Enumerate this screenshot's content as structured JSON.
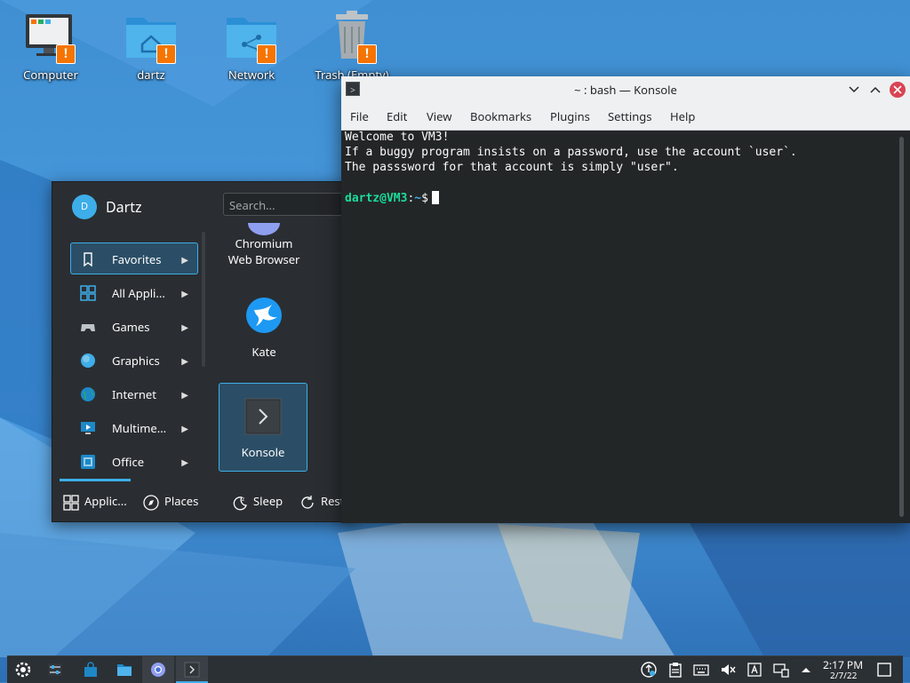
{
  "desktop": {
    "icons": [
      {
        "label": "Computer",
        "badge": "!"
      },
      {
        "label": "dartz",
        "badge": "!"
      },
      {
        "label": "Network",
        "badge": "!"
      },
      {
        "label": "Trash (Empty)",
        "badge": "!"
      }
    ]
  },
  "launcher": {
    "user_initial": "D",
    "user_name": "Dartz",
    "search_placeholder": "Search...",
    "categories": [
      {
        "label": "Favorites",
        "icon": "bookmark-icon"
      },
      {
        "label": "All Appli...",
        "icon": "grid-icon"
      },
      {
        "label": "Games",
        "icon": "gamepad-icon"
      },
      {
        "label": "Graphics",
        "icon": "graphics-icon"
      },
      {
        "label": "Internet",
        "icon": "globe-icon"
      },
      {
        "label": "Multime...",
        "icon": "multimedia-icon"
      },
      {
        "label": "Office",
        "icon": "office-icon"
      }
    ],
    "apps": [
      {
        "label": "Chromium\nWeb Browser",
        "line1": "Chromium",
        "line2": "Web Browser"
      },
      {
        "label": "Kate"
      },
      {
        "label": "Konsole"
      }
    ],
    "footer": {
      "applications": "Applic...",
      "places": "Places",
      "sleep": "Sleep",
      "restart": "Rest"
    }
  },
  "konsole": {
    "title": "~ : bash — Konsole",
    "menu": [
      "File",
      "Edit",
      "View",
      "Bookmarks",
      "Plugins",
      "Settings",
      "Help"
    ],
    "output_lines": [
      "Welcome to VM3!",
      "If a buggy program insists on a password, use the account `user`.",
      "The passsword for that account is simply \"user\"."
    ],
    "prompt_user": "dartz@VM3",
    "prompt_sep": ":",
    "prompt_path": "~",
    "prompt_symbol": "$"
  },
  "taskbar": {
    "clock_time": "2:17 PM",
    "clock_date": "2/7/22"
  },
  "colors": {
    "accent": "#3daee9",
    "warning_badge": "#f67400",
    "close_button": "#da4453",
    "prompt_user": "#1cdc9a"
  }
}
